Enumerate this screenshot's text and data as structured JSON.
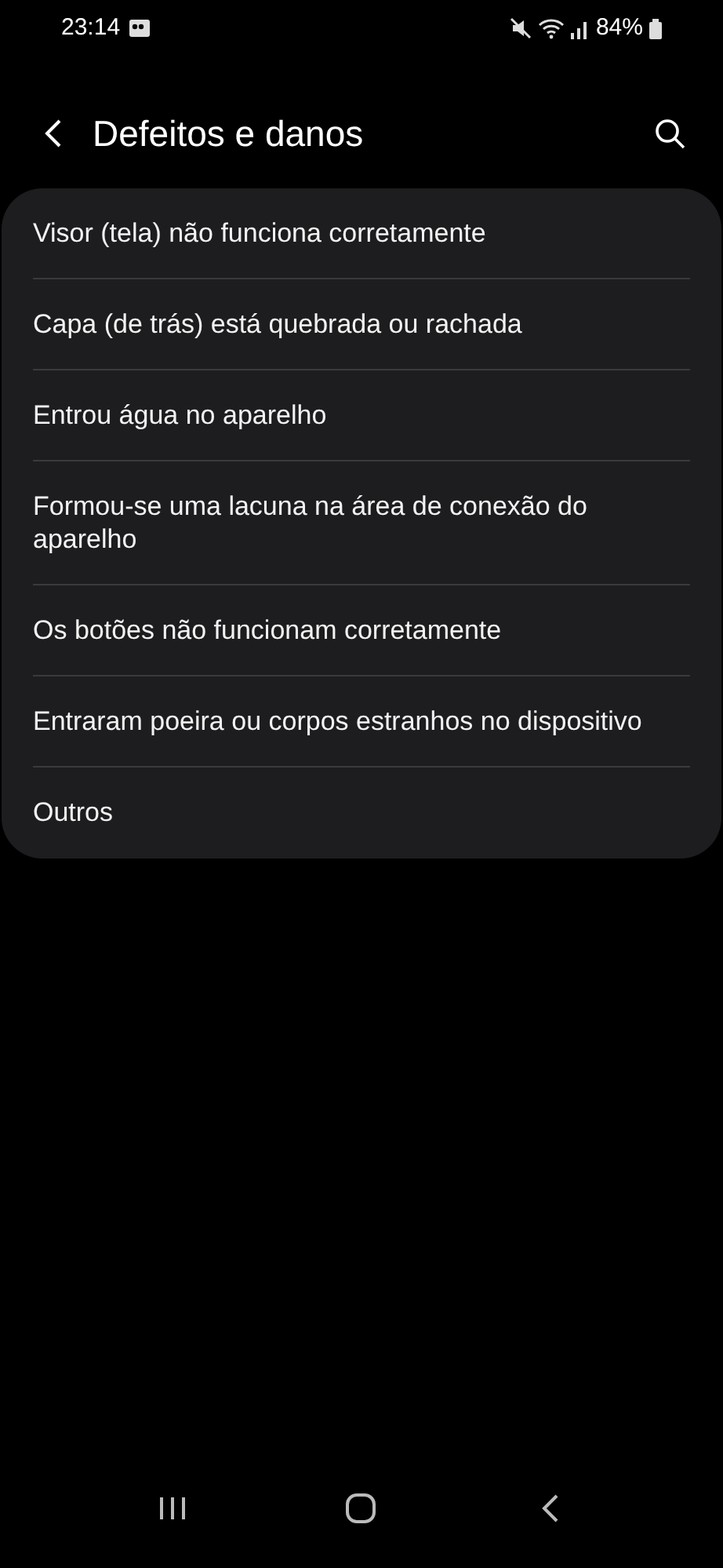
{
  "status_bar": {
    "time": "23:14",
    "battery": "84%"
  },
  "header": {
    "title": "Defeitos e danos"
  },
  "items": [
    {
      "label": "Visor (tela) não funciona corretamente"
    },
    {
      "label": "Capa (de trás) está quebrada ou rachada"
    },
    {
      "label": "Entrou água no aparelho"
    },
    {
      "label": "Formou-se uma lacuna na área de conexão do aparelho"
    },
    {
      "label": "Os botões não funcionam corretamente"
    },
    {
      "label": "Entraram poeira ou corpos estranhos no dispositivo"
    },
    {
      "label": "Outros"
    }
  ]
}
